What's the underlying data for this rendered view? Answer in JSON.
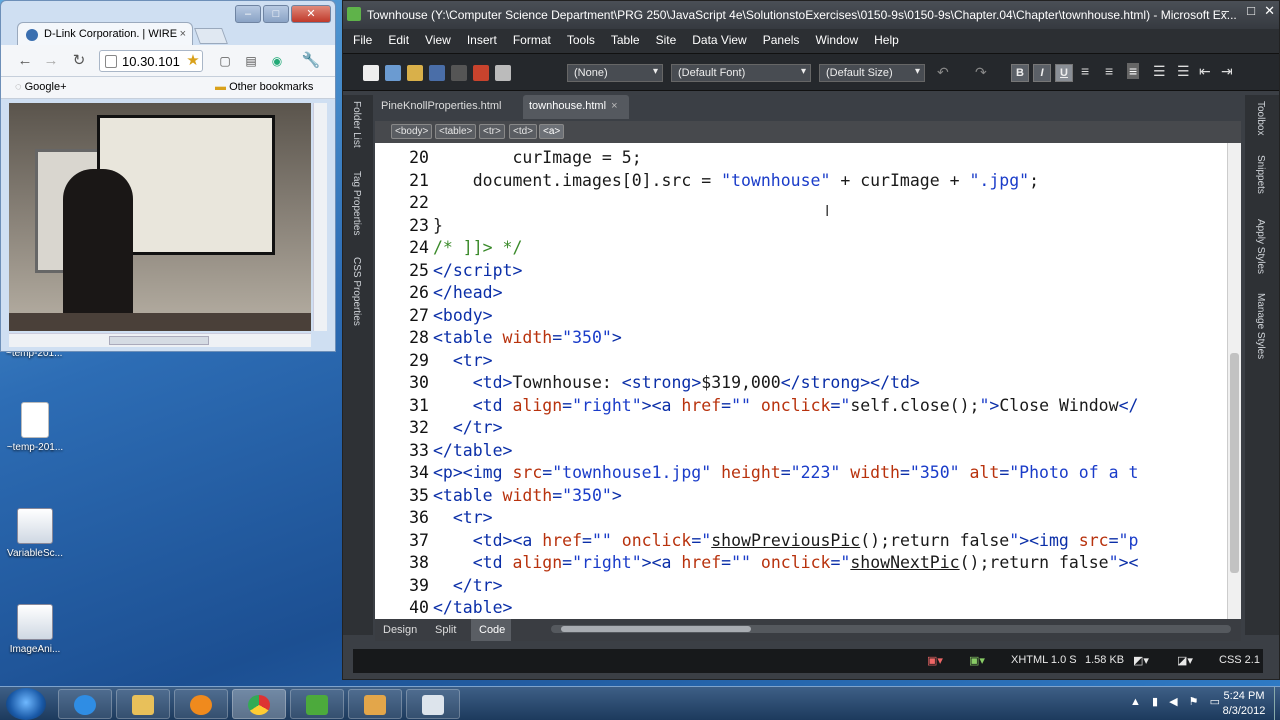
{
  "desktop": {
    "icons": [
      {
        "label": "~temp-201..."
      },
      {
        "label": "VariableSc..."
      },
      {
        "label": "ImageAni..."
      }
    ],
    "partial_label": "~temp-201..."
  },
  "browser": {
    "tab_title": "D-Link Corporation. | WIRE",
    "tab_close": "×",
    "address": "10.30.101",
    "bookmark_google": "Google+",
    "bookmark_other": "Other bookmarks",
    "btn_min": "–",
    "btn_max": "□",
    "btn_close": "✕"
  },
  "editor": {
    "title": "Townhouse (Y:\\Computer Science Department\\PRG 250\\JavaScript 4e\\SolutionstoExercises\\0150-9s\\0150-9s\\Chapter.04\\Chapter\\townhouse.html) - Microsoft Ex...",
    "menu": [
      "File",
      "Edit",
      "View",
      "Insert",
      "Format",
      "Tools",
      "Table",
      "Site",
      "Data View",
      "Panels",
      "Window",
      "Help"
    ],
    "style_select": "(None)",
    "font_select": "(Default Font)",
    "size_select": "(Default Size)",
    "format_buttons": [
      "B",
      "I",
      "U"
    ],
    "tabs": [
      {
        "label": "PineKnollProperties.html"
      },
      {
        "label": "townhouse.html",
        "close": "×"
      }
    ],
    "tag_selector": [
      "<body>",
      "<table>",
      "<tr>",
      "<td>",
      "<a>"
    ],
    "left_panels": [
      "Folder List",
      "Tag Properties",
      "CSS Properties"
    ],
    "right_panels": [
      "Toolbox",
      "Snippets",
      "Apply Styles",
      "Manage Styles"
    ],
    "view_buttons": [
      "Design",
      "Split",
      "Code"
    ],
    "status": {
      "doctype": "XHTML 1.0 S",
      "size": "1.58 KB",
      "css": "CSS 2.1"
    },
    "code_lines": [
      {
        "n": "20",
        "indent": "    ",
        "html": "<span class='k'>curImage = 5;</span>"
      },
      {
        "n": "21",
        "indent": "  ",
        "html": "<span class='k'>document.images[0].src = </span><span class='st'>\"townhouse\"</span><span class='k'> + curImage + </span><span class='st'>\".jpg\"</span><span class='k'>;</span>"
      },
      {
        "n": "22",
        "indent": "",
        "html": ""
      },
      {
        "n": "23",
        "indent": "",
        "html": "<span class='k'>}</span>"
      },
      {
        "n": "24",
        "indent": "",
        "html": "<span class='c'>/* ]]&gt; */</span>"
      },
      {
        "n": "25",
        "indent": "",
        "html": "<span class='t'>&lt;/script&gt;</span>"
      },
      {
        "n": "26",
        "indent": "",
        "html": "<span class='t'>&lt;/head&gt;</span>"
      },
      {
        "n": "27",
        "indent": "",
        "html": "<span class='t'>&lt;body&gt;</span>"
      },
      {
        "n": "28",
        "indent": "",
        "html": "<span class='t'>&lt;table </span><span class='a'>width</span><span class='t'>=</span><span class='s'>\"350\"</span><span class='t'>&gt;</span>"
      },
      {
        "n": "29",
        "indent": " ",
        "html": "<span class='t'>&lt;tr&gt;</span>"
      },
      {
        "n": "30",
        "indent": "  ",
        "html": "<span class='t'>&lt;td&gt;</span><span class='k'>Townhouse: </span><span class='t'>&lt;strong&gt;</span><span class='k'>$319,000</span><span class='t'>&lt;/strong&gt;&lt;/td&gt;</span>"
      },
      {
        "n": "31",
        "indent": "  ",
        "html": "<span class='t'>&lt;td </span><span class='a'>align</span><span class='t'>=</span><span class='s'>\"right\"</span><span class='t'>&gt;&lt;a </span><span class='a'>href</span><span class='t'>=</span><span class='s'>\"\"</span><span class='t'> </span><span class='a'>onclick</span><span class='t'>=</span><span class='s'>\"</span><span class='k'>self.close();</span><span class='s'>\"</span><span class='t'>&gt;</span><span class='k'>Close Window</span><span class='t'>&lt;/</span>"
      },
      {
        "n": "32",
        "indent": " ",
        "html": "<span class='t'>&lt;/tr&gt;</span>"
      },
      {
        "n": "33",
        "indent": "",
        "html": "<span class='t'>&lt;/table&gt;</span>"
      },
      {
        "n": "34",
        "indent": "",
        "html": "<span class='t'>&lt;p&gt;&lt;img </span><span class='a'>src</span><span class='t'>=</span><span class='s'>\"townhouse1.jpg\"</span><span class='t'> </span><span class='a'>height</span><span class='t'>=</span><span class='s'>\"223\"</span><span class='t'> </span><span class='a'>width</span><span class='t'>=</span><span class='s'>\"350\"</span><span class='t'> </span><span class='a'>alt</span><span class='t'>=</span><span class='s'>\"Photo of a t</span>"
      },
      {
        "n": "35",
        "indent": "",
        "html": "<span class='t'>&lt;table </span><span class='a'>width</span><span class='t'>=</span><span class='s'>\"350\"</span><span class='t'>&gt;</span>"
      },
      {
        "n": "36",
        "indent": " ",
        "html": "<span class='t'>&lt;tr&gt;</span>"
      },
      {
        "n": "37",
        "indent": "  ",
        "html": "<span class='t'>&lt;td&gt;&lt;a </span><span class='a'>href</span><span class='t'>=</span><span class='s'>\"\"</span><span class='t'> </span><span class='a'>onclick</span><span class='t'>=</span><span class='s'>\"</span><span class='k u'>showPreviousPic</span><span class='k'>();return false</span><span class='s'>\"</span><span class='t'>&gt;&lt;img </span><span class='a'>src</span><span class='t'>=</span><span class='s'>\"p</span>"
      },
      {
        "n": "38",
        "indent": "  ",
        "html": "<span class='t'>&lt;td </span><span class='a'>align</span><span class='t'>=</span><span class='s'>\"right\"</span><span class='t'>&gt;&lt;a </span><span class='a'>href</span><span class='t'>=</span><span class='s'>\"\"</span><span class='t'> </span><span class='a'>onclick</span><span class='t'>=</span><span class='s'>\"</span><span class='k u'>showNextPic</span><span class='k'>();return false</span><span class='s'>\"</span><span class='t'>&gt;&lt;</span>"
      },
      {
        "n": "39",
        "indent": " ",
        "html": "<span class='t'>&lt;/tr&gt;</span>"
      },
      {
        "n": "40",
        "indent": "",
        "html": "<span class='t'>&lt;/table&gt;</span>"
      }
    ]
  },
  "taskbar": {
    "time": "5:24 PM",
    "date": "8/3/2012",
    "apps": [
      "ie",
      "explorer",
      "media",
      "chrome",
      "excel",
      "visio",
      "window"
    ]
  }
}
